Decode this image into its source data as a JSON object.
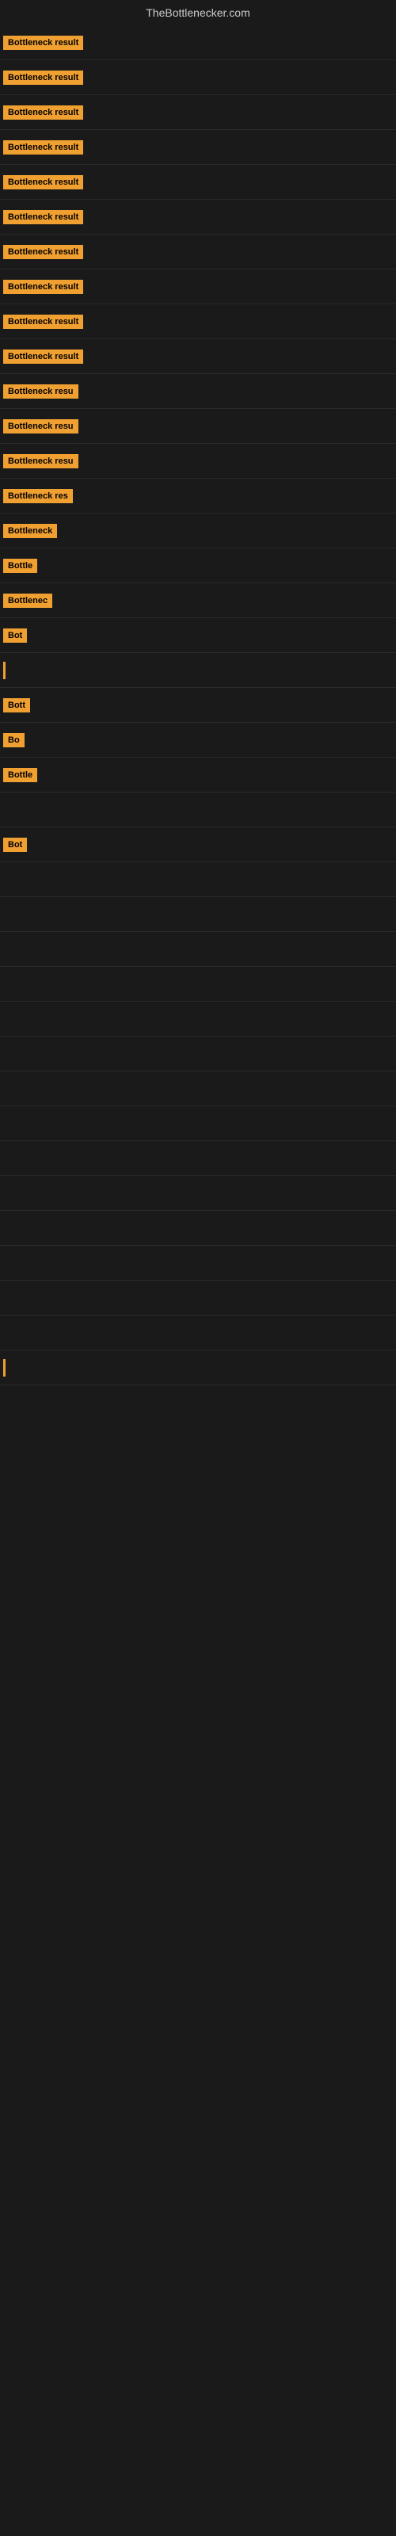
{
  "site": {
    "title": "TheBottlenecker.com"
  },
  "rows": [
    {
      "id": 1,
      "label": "Bottleneck result",
      "width": 155
    },
    {
      "id": 2,
      "label": "Bottleneck result",
      "width": 155
    },
    {
      "id": 3,
      "label": "Bottleneck result",
      "width": 155
    },
    {
      "id": 4,
      "label": "Bottleneck result",
      "width": 155
    },
    {
      "id": 5,
      "label": "Bottleneck result",
      "width": 155
    },
    {
      "id": 6,
      "label": "Bottleneck result",
      "width": 152
    },
    {
      "id": 7,
      "label": "Bottleneck result",
      "width": 152
    },
    {
      "id": 8,
      "label": "Bottleneck result",
      "width": 149
    },
    {
      "id": 9,
      "label": "Bottleneck result",
      "width": 149
    },
    {
      "id": 10,
      "label": "Bottleneck result",
      "width": 146
    },
    {
      "id": 11,
      "label": "Bottleneck resu",
      "width": 130
    },
    {
      "id": 12,
      "label": "Bottleneck resu",
      "width": 125
    },
    {
      "id": 13,
      "label": "Bottleneck resu",
      "width": 120
    },
    {
      "id": 14,
      "label": "Bottleneck res",
      "width": 110
    },
    {
      "id": 15,
      "label": "Bottleneck",
      "width": 90
    },
    {
      "id": 16,
      "label": "Bottle",
      "width": 60
    },
    {
      "id": 17,
      "label": "Bottlenec",
      "width": 78
    },
    {
      "id": 18,
      "label": "Bot",
      "width": 38
    },
    {
      "id": 19,
      "cursor": true
    },
    {
      "id": 20,
      "label": "Bott",
      "width": 42
    },
    {
      "id": 21,
      "label": "Bo",
      "width": 28
    },
    {
      "id": 22,
      "label": "Bottle",
      "width": 58
    },
    {
      "id": 23,
      "label": "",
      "width": 0,
      "empty": true
    },
    {
      "id": 24,
      "label": "Bot",
      "width": 38
    },
    {
      "id": 25,
      "label": "",
      "width": 0,
      "empty": true
    },
    {
      "id": 26,
      "label": "",
      "width": 0,
      "empty": true
    },
    {
      "id": 27,
      "label": "",
      "width": 0,
      "empty": true
    },
    {
      "id": 28,
      "label": "",
      "width": 0,
      "empty": true
    },
    {
      "id": 29,
      "label": "",
      "width": 0,
      "empty": true
    },
    {
      "id": 30,
      "label": "",
      "width": 0,
      "empty": true
    },
    {
      "id": 31,
      "label": "",
      "width": 0,
      "empty": true
    },
    {
      "id": 32,
      "label": "",
      "width": 0,
      "empty": true
    },
    {
      "id": 33,
      "label": "",
      "width": 0,
      "empty": true
    },
    {
      "id": 34,
      "label": "",
      "width": 0,
      "empty": true
    },
    {
      "id": 35,
      "label": "",
      "width": 0,
      "empty": true
    },
    {
      "id": 36,
      "label": "",
      "width": 0,
      "empty": true
    },
    {
      "id": 37,
      "label": "",
      "width": 0,
      "empty": true
    },
    {
      "id": 38,
      "label": "",
      "width": 0,
      "empty": true
    },
    {
      "id": 39,
      "cursor2": true
    }
  ]
}
